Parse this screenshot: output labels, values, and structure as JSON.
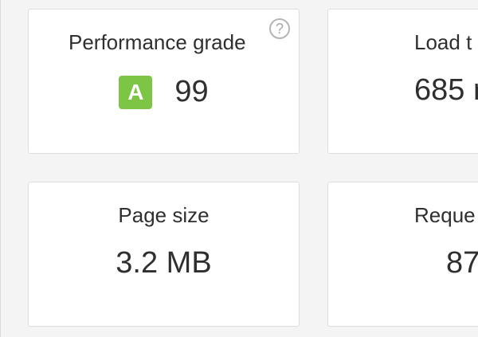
{
  "cards": {
    "performance": {
      "title": "Performance grade",
      "grade": "A",
      "score": "99",
      "help_glyph": "?",
      "help_icon": "help-circle-icon",
      "grade_color": "#7dc544"
    },
    "load_time": {
      "title": "Load t",
      "value": "685 r"
    },
    "page_size": {
      "title": "Page size",
      "value": "3.2 MB"
    },
    "requests": {
      "title": "Reque",
      "value": "87"
    }
  },
  "colors": {
    "background": "#f4f4f4",
    "card": "#ffffff",
    "border": "#dedede",
    "text": "#2f2f2f",
    "grade_badge": "#7dc544"
  }
}
